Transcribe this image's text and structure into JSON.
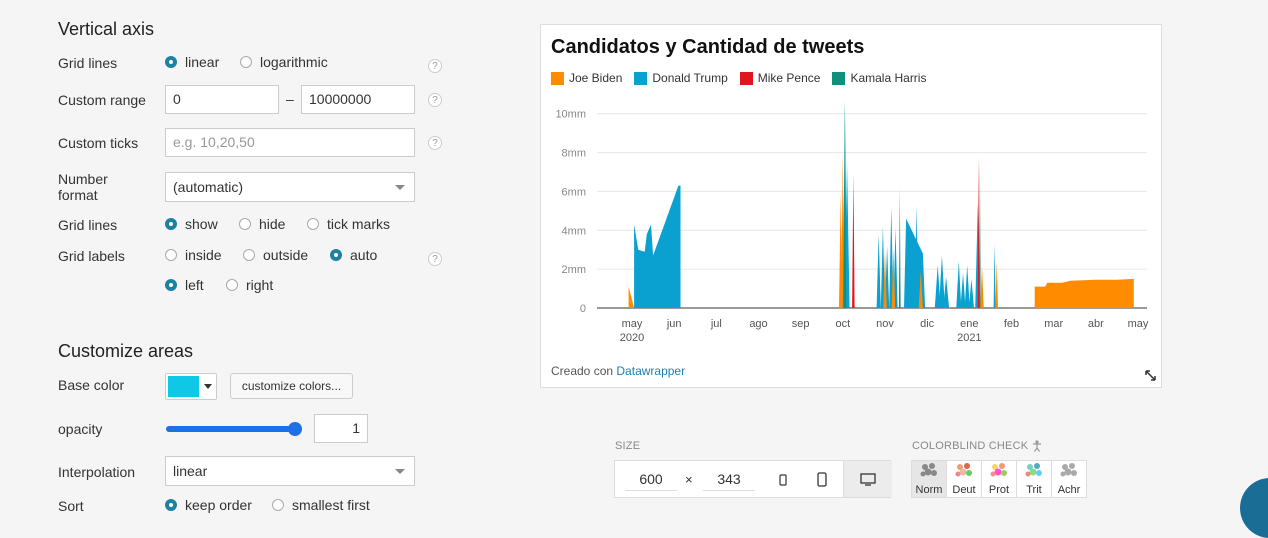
{
  "vertical_axis": {
    "title": "Vertical axis",
    "grid_lines_label": "Grid lines",
    "grid_lines_options": [
      "linear",
      "logarithmic"
    ],
    "custom_range_label": "Custom range",
    "range_min": "0",
    "range_sep": "–",
    "range_max": "10000000",
    "custom_ticks_label": "Custom ticks",
    "custom_ticks_placeholder": "e.g. 10,20,50",
    "number_format_label": "Number format",
    "number_format_value": "(automatic)",
    "grid_lines2_label": "Grid lines",
    "grid_lines2_options": [
      "show",
      "hide",
      "tick marks"
    ],
    "grid_labels_label": "Grid labels",
    "grid_labels_options": [
      "inside",
      "outside",
      "auto"
    ],
    "grid_labels_side": [
      "left",
      "right"
    ],
    "help": "?"
  },
  "areas": {
    "title": "Customize areas",
    "base_color_label": "Base color",
    "base_color": "#0fc8e6",
    "customize_colors_button": "customize colors...",
    "opacity_label": "opacity",
    "opacity_value": "1",
    "interpolation_label": "Interpolation",
    "interpolation_value": "linear",
    "sort_label": "Sort",
    "sort_options": [
      "keep order",
      "smallest first"
    ]
  },
  "size": {
    "title": "SIZE",
    "width": "600",
    "times": "×",
    "height": "343"
  },
  "colorblind": {
    "title": "COLORBLIND CHECK",
    "options": [
      "Norm",
      "Deut",
      "Prot",
      "Trit",
      "Achr"
    ]
  },
  "chart_footer": {
    "credit": "Creado con",
    "link": "Datawrapper"
  },
  "chart_data": {
    "type": "area",
    "title": "Candidatos y Cantidad de tweets",
    "series": [
      {
        "name": "Joe Biden",
        "color": "#ff8c00"
      },
      {
        "name": "Donald Trump",
        "color": "#0aa1d1"
      },
      {
        "name": "Mike Pence",
        "color": "#e0161e"
      },
      {
        "name": "Kamala Harris",
        "color": "#10907a"
      }
    ],
    "y_ticks": [
      "0",
      "2mm",
      "4mm",
      "6mm",
      "8mm",
      "10mm"
    ],
    "ylim": [
      0,
      10000000
    ],
    "x_ticks": [
      "may",
      "jun",
      "jul",
      "ago",
      "sep",
      "oct",
      "nov",
      "dic",
      "ene",
      "feb",
      "mar",
      "abr",
      "may"
    ],
    "x_years": [
      "2020",
      "2021"
    ],
    "grid": true,
    "approx_values": {
      "Donald Trump": [
        {
          "period": "may 2020",
          "value": 4300000
        },
        {
          "period": "jun 2020",
          "value": 6300000
        },
        {
          "period": "oct 2020",
          "value": 10700000
        },
        {
          "period": "nov 2020",
          "value": 5300000
        },
        {
          "period": "dic 2020",
          "value": 4500000
        },
        {
          "period": "ene 2021",
          "value": 7800000
        }
      ],
      "Joe Biden": [
        {
          "period": "oct 2020",
          "value": 8000000
        },
        {
          "period": "ene 2021",
          "value": 2400000
        },
        {
          "period": "mar 2021",
          "value": 1100000
        },
        {
          "period": "may 2021",
          "value": 1500000
        }
      ],
      "Mike Pence": [
        {
          "period": "oct 2020",
          "value": 6900000
        }
      ],
      "Kamala Harris": [
        {
          "period": "ene 2021",
          "value": 7800000
        }
      ]
    }
  }
}
